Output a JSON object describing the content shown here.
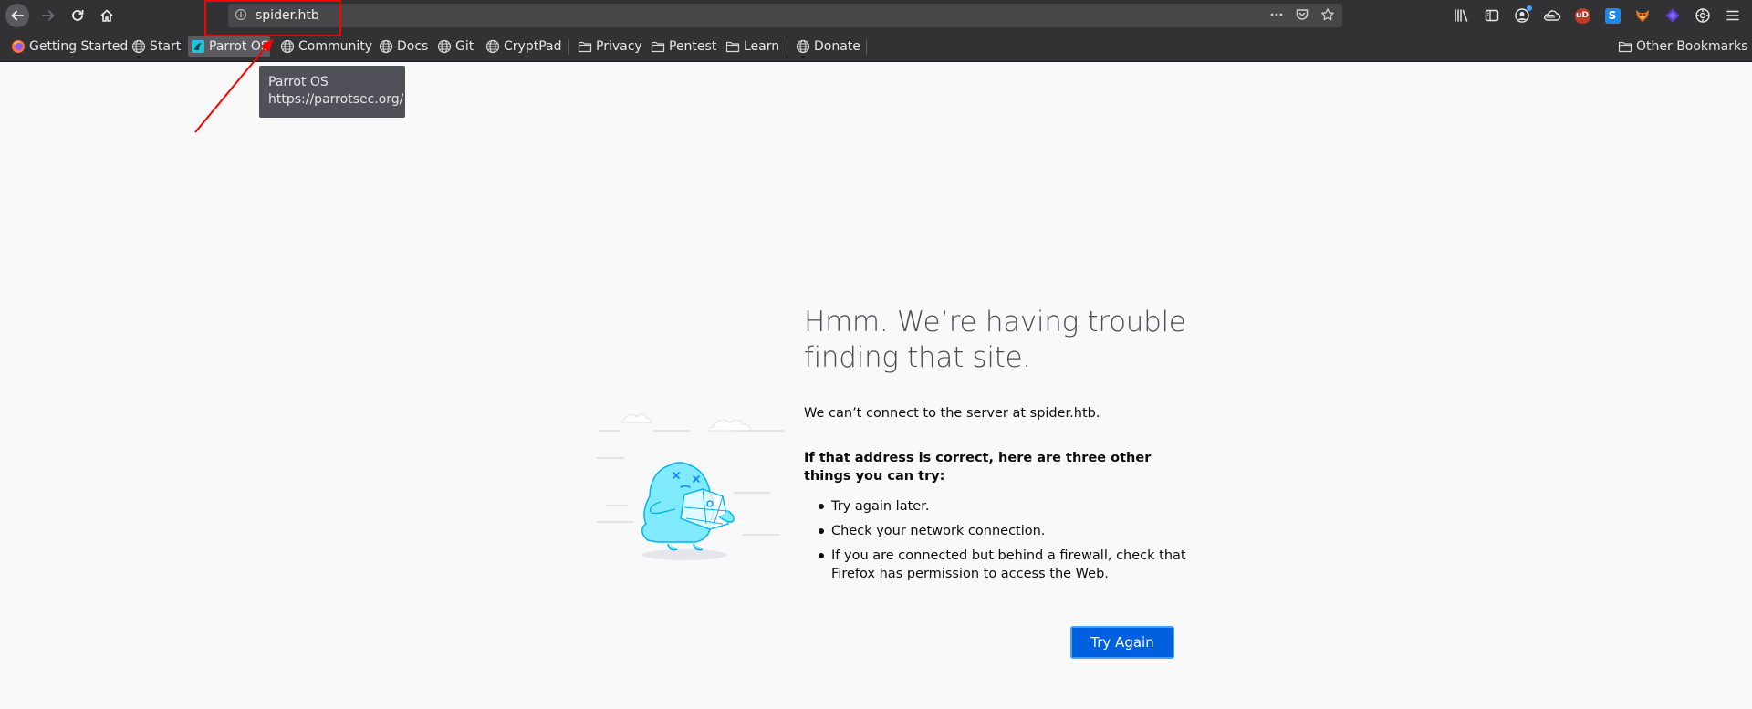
{
  "toolbar": {
    "url": "spider.htb",
    "icons": [
      "back-arrow-icon",
      "forward-arrow-icon",
      "reload-icon",
      "home-icon",
      "info-icon",
      "more-dots-icon",
      "pocket-icon",
      "star-icon",
      "library-icon",
      "sidebar-icon",
      "account-icon",
      "cloud-icon",
      "ublock-icon",
      "s-extension-icon",
      "fox-extension-icon",
      "purple-extension-icon",
      "settings-icon",
      "menu-icon"
    ],
    "ublock_label": "uD",
    "s_ext_label": "S"
  },
  "bookmarks": {
    "items": [
      "Getting Started",
      "Start",
      "Parrot OS",
      "Community",
      "Docs",
      "Git",
      "CryptPad"
    ],
    "folders": [
      "Privacy",
      "Pentest",
      "Learn"
    ],
    "donate": "Donate",
    "other": "Other Bookmarks"
  },
  "tooltip": {
    "title": "Parrot OS",
    "url": "https://parrotsec.org/"
  },
  "error": {
    "title": "Hmm. We’re having trouble finding that site.",
    "short_desc": "We can’t connect to the server at spider.htb.",
    "suggest_heading": "If that address is correct, here are three other things you can try:",
    "suggestions": [
      "Try again later.",
      "Check your network connection.",
      "If you are connected but behind a firewall, check that Firefox has permission to access the Web."
    ],
    "try_again": "Try Again"
  },
  "colors": {
    "chrome": "#323234",
    "urlbar": "#474749",
    "page_bg": "#f9f9fa",
    "button": "#0060df",
    "annotation": "#ff0000"
  }
}
